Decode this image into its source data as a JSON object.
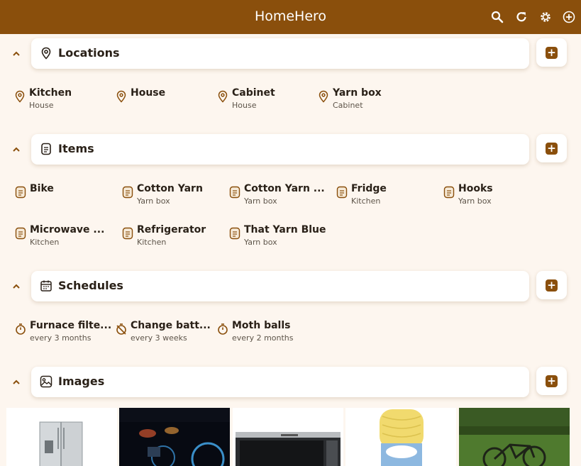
{
  "app": {
    "title": "HomeHero",
    "actions": [
      "search-icon",
      "refresh-icon",
      "settings-icon",
      "add-circle-icon"
    ]
  },
  "colors": {
    "primary": "#8a4f0c",
    "background": "#fdf6ef",
    "card": "#ffffff"
  },
  "locations": {
    "title": "Locations",
    "entries": [
      {
        "name": "Kitchen",
        "sub": "House"
      },
      {
        "name": "House",
        "sub": ""
      },
      {
        "name": "Cabinet",
        "sub": "House"
      },
      {
        "name": "Yarn box",
        "sub": "Cabinet"
      }
    ]
  },
  "items": {
    "title": "Items",
    "entries": [
      {
        "name": "Bike",
        "sub": ""
      },
      {
        "name": "Cotton Yarn",
        "sub": "Yarn box"
      },
      {
        "name": "Cotton Yarn ...",
        "sub": "Yarn box"
      },
      {
        "name": "Fridge",
        "sub": "Kitchen"
      },
      {
        "name": "Hooks",
        "sub": "Yarn box"
      },
      {
        "name": "Microwave ...",
        "sub": "Kitchen"
      },
      {
        "name": "Refrigerator",
        "sub": "Kitchen"
      },
      {
        "name": "That Yarn Blue",
        "sub": "Yarn box"
      }
    ]
  },
  "schedules": {
    "title": "Schedules",
    "entries": [
      {
        "name": "Furnace filte...",
        "sub": "every 3 months",
        "icon": "timer-icon"
      },
      {
        "name": "Change batt...",
        "sub": "every 3 weeks",
        "icon": "timer-off-icon"
      },
      {
        "name": "Moth balls",
        "sub": "every 2 months",
        "icon": "timer-icon"
      }
    ]
  },
  "images": {
    "title": "Images",
    "thumbnails": [
      "refrigerator-photo",
      "car-dashboard-photo",
      "microwave-photo",
      "yarn-ball-photo",
      "bicycle-photo"
    ]
  }
}
